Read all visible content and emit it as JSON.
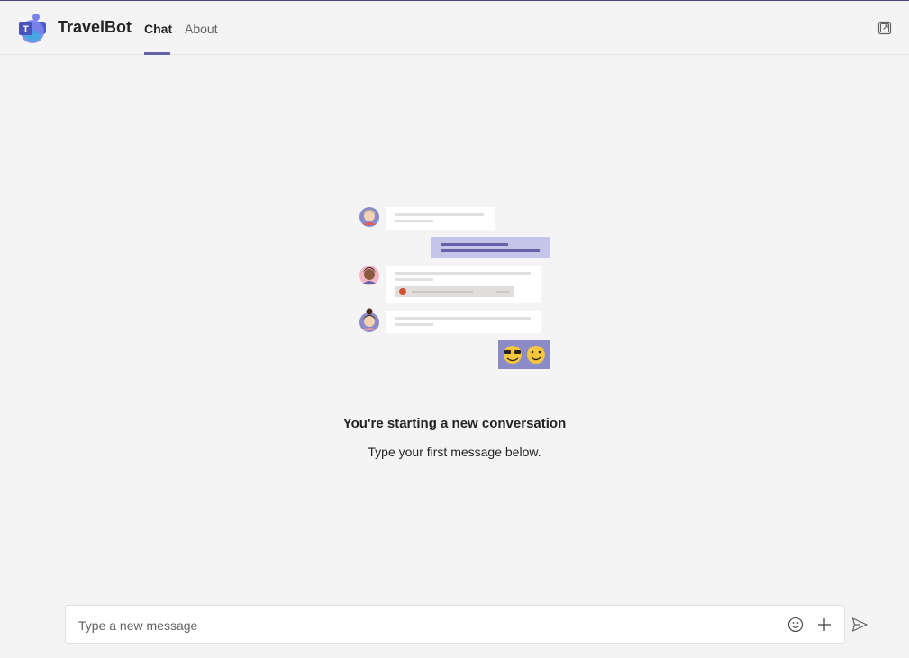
{
  "app": {
    "title": "TravelBot",
    "logo_icon": "teams-logo-icon"
  },
  "tabs": [
    {
      "label": "Chat",
      "active": true
    },
    {
      "label": "About",
      "active": false
    }
  ],
  "header": {
    "popout_icon": "popout-icon"
  },
  "empty_state": {
    "title": "You're starting a new conversation",
    "subtitle": "Type your first message below."
  },
  "composer": {
    "placeholder": "Type a new message",
    "value": "",
    "emoji_icon": "emoji-icon",
    "attach_icon": "plus-icon",
    "send_icon": "send-icon"
  },
  "colors": {
    "accent": "#6264a7",
    "background": "#f4f4f4",
    "bubble_purple": "#c5c5e9",
    "emoji_bubble": "#8b8cc7"
  }
}
